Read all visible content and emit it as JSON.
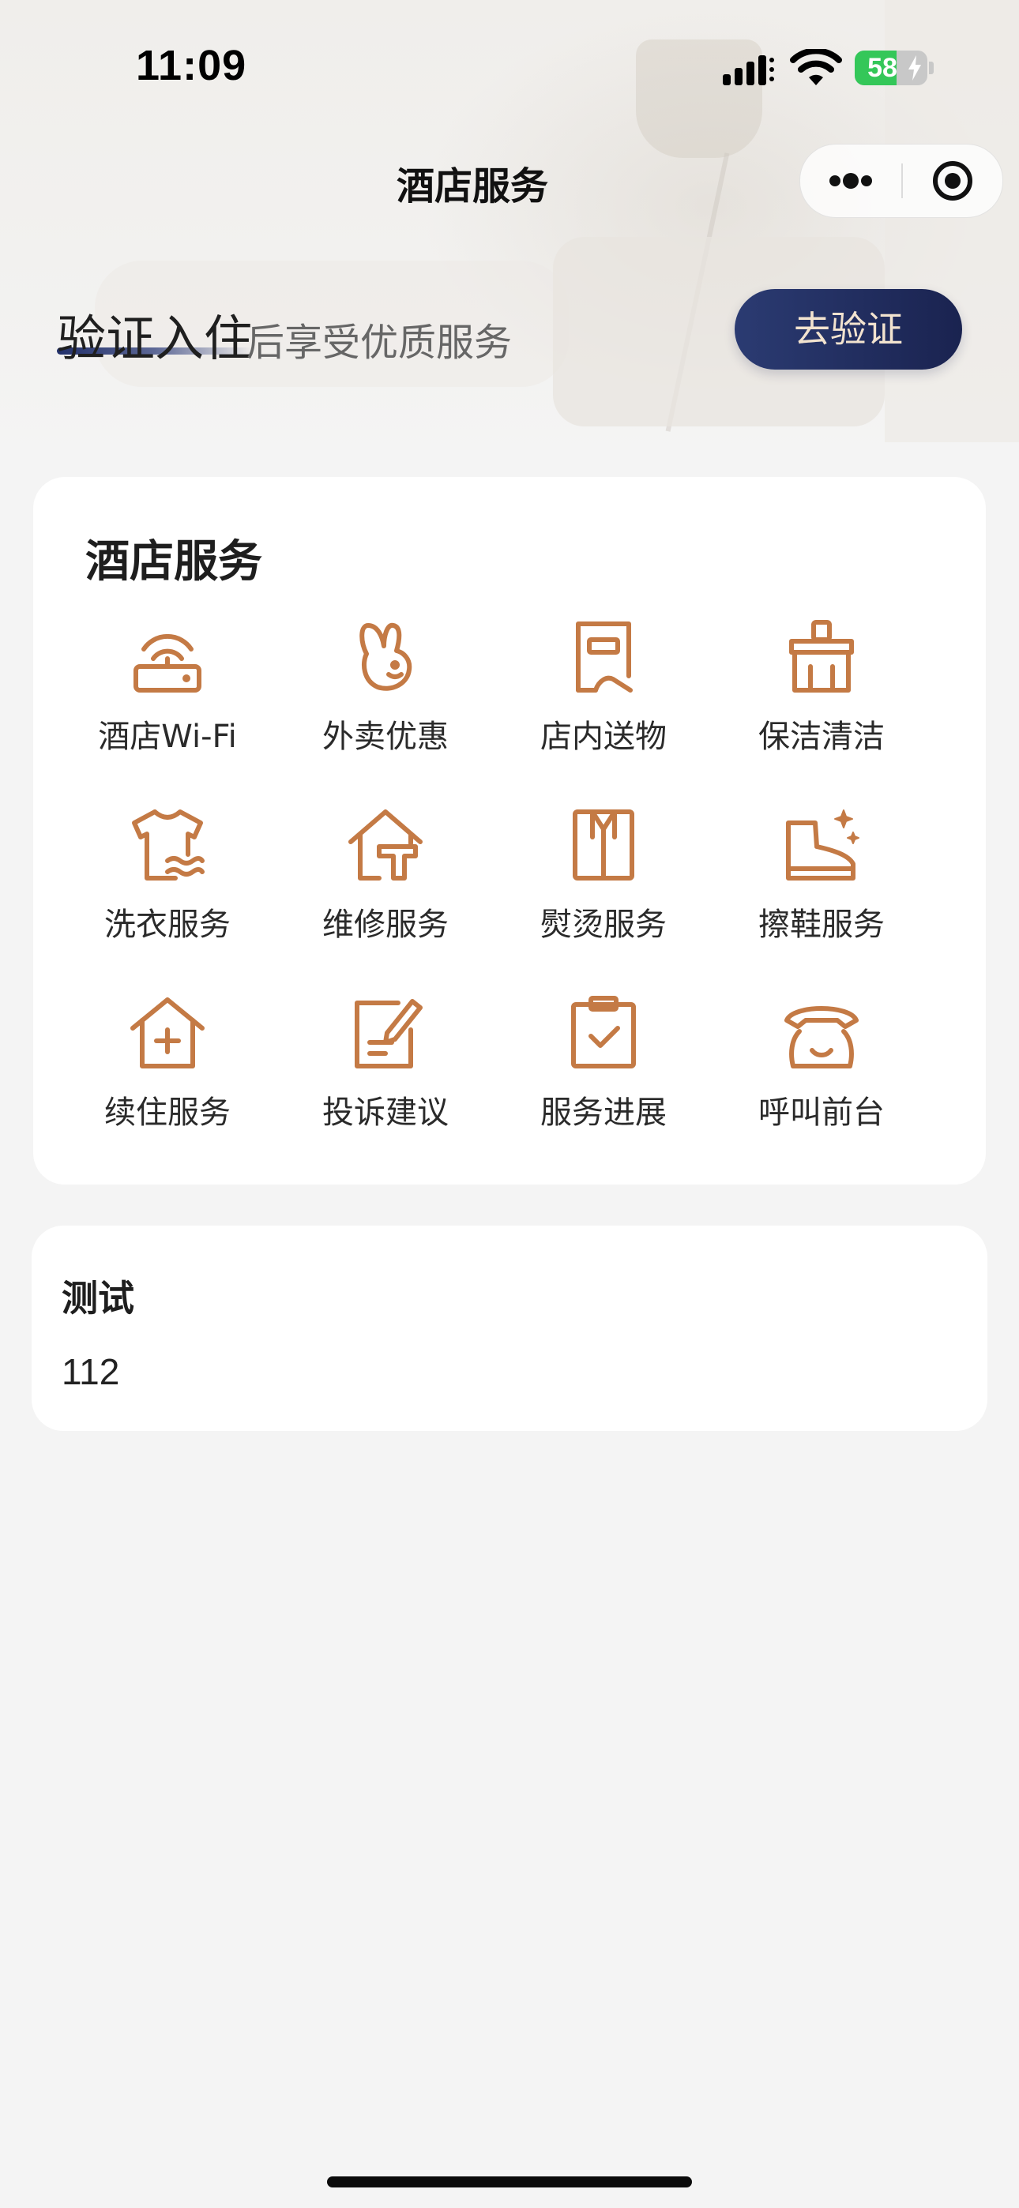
{
  "status_bar": {
    "time": "11:09",
    "battery_percent": 58,
    "battery_label": "58",
    "icons": [
      "cellular-signal-icon",
      "wifi-icon",
      "battery-charging-icon"
    ]
  },
  "nav": {
    "title": "酒店服务",
    "capsule_icons": [
      "more-dots-icon",
      "close-circle-icon"
    ]
  },
  "verify": {
    "headline": "验证入住",
    "subtitle": "后享受优质服务",
    "button": "去验证"
  },
  "services": {
    "title": "酒店服务",
    "icon_color": "#c47a45",
    "items": [
      {
        "label": "酒店Wi-Fi",
        "icon": "wifi-router-icon"
      },
      {
        "label": "外卖优惠",
        "icon": "rabbit-mascot-icon"
      },
      {
        "label": "店内送物",
        "icon": "delivery-box-icon"
      },
      {
        "label": "保洁清洁",
        "icon": "broom-icon"
      },
      {
        "label": "洗衣服务",
        "icon": "tshirt-wash-icon"
      },
      {
        "label": "维修服务",
        "icon": "house-tool-icon"
      },
      {
        "label": "熨烫服务",
        "icon": "shirt-iron-icon"
      },
      {
        "label": "擦鞋服务",
        "icon": "shoe-shine-icon"
      },
      {
        "label": "续住服务",
        "icon": "house-plus-icon"
      },
      {
        "label": "投诉建议",
        "icon": "document-edit-icon"
      },
      {
        "label": "服务进展",
        "icon": "clipboard-check-icon"
      },
      {
        "label": "呼叫前台",
        "icon": "telephone-icon"
      }
    ]
  },
  "test_card": {
    "title": "测试",
    "value": "112"
  },
  "colors": {
    "accent_icon": "#c47a45",
    "verify_button_bg": "#1f2a5c",
    "verify_button_text": "#f2e3cf",
    "page_bg": "#f4f4f4"
  }
}
